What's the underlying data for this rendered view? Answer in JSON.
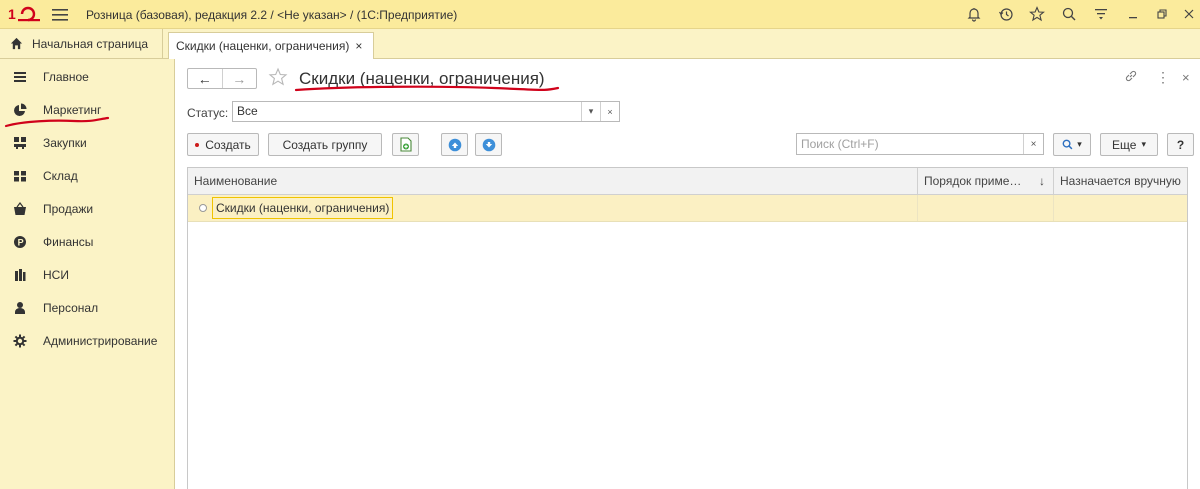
{
  "titlebar": {
    "logo_text": "1C",
    "app_title": "Розница (базовая), редакция 2.2 / <Не указан> /  (1С:Предприятие)"
  },
  "tabs": {
    "home_label": "Начальная страница",
    "active_label": "Скидки (наценки, ограничения)",
    "active_close": "×"
  },
  "sidebar": {
    "items": [
      {
        "label": "Главное",
        "icon": "list-icon"
      },
      {
        "label": "Маркетинг",
        "icon": "pie-chart-icon"
      },
      {
        "label": "Закупки",
        "icon": "cart-icon"
      },
      {
        "label": "Склад",
        "icon": "warehouse-icon"
      },
      {
        "label": "Продажи",
        "icon": "basket-icon"
      },
      {
        "label": "Финансы",
        "icon": "coin-icon"
      },
      {
        "label": "НСИ",
        "icon": "books-icon"
      },
      {
        "label": "Персонал",
        "icon": "person-icon"
      },
      {
        "label": "Администрирование",
        "icon": "gear-icon"
      }
    ]
  },
  "form": {
    "title": "Скидки (наценки, ограничения)",
    "back_glyph": "←",
    "forward_glyph": "→",
    "link_glyph": "🔗",
    "more_glyph": "⋮",
    "close_glyph": "×",
    "status_label": "Статус:",
    "status_value": "Все",
    "status_dropdown_glyph": "▾",
    "status_clear_glyph": "×"
  },
  "toolbar": {
    "create_label": "Создать",
    "create_group_label": "Создать группу",
    "search_placeholder": "Поиск (Ctrl+F)",
    "search_clear_glyph": "×",
    "more_label": "Еще",
    "more_caret": "▾",
    "search_caret": "▾",
    "help_label": "?"
  },
  "table": {
    "columns": [
      "Наименование",
      "Порядок приме…",
      "Назначается вручную"
    ],
    "sort_glyph": "↓",
    "rows": [
      {
        "name": "Скидки (наценки, ограничения)",
        "order": "",
        "manual": ""
      }
    ]
  },
  "colors": {
    "accent_yellow": "#fbeb9c",
    "annotation_red": "#d0021b",
    "selected_row": "#fbf0c3"
  }
}
